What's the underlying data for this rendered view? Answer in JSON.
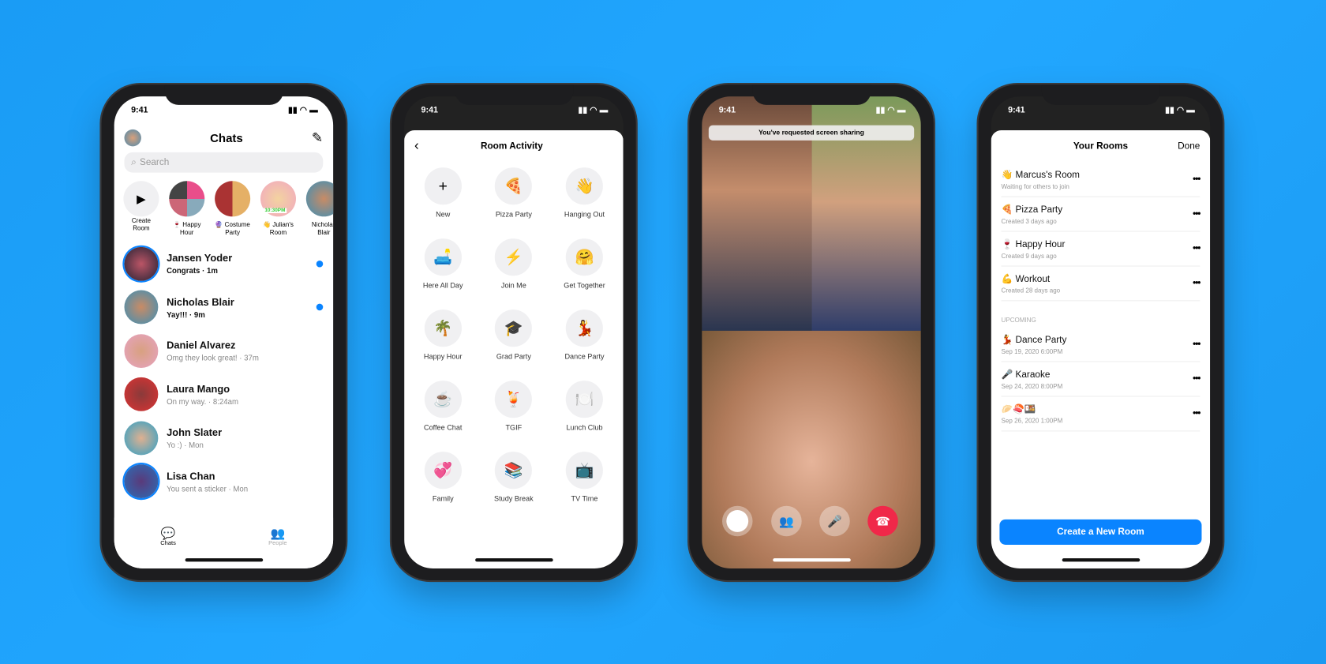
{
  "status_time": "9:41",
  "chats": {
    "title": "Chats",
    "search_placeholder": "Search",
    "stories": [
      {
        "label": "Create Room"
      },
      {
        "label": "🍷 Happy Hour"
      },
      {
        "label": "🔮 Costume Party"
      },
      {
        "label": "👋 Julian's Room",
        "badge": "10:30PM"
      },
      {
        "label": "Nicholas Blair"
      }
    ],
    "items": [
      {
        "name": "Jansen Yoder",
        "preview": "Congrats · 1m",
        "unread": true
      },
      {
        "name": "Nicholas Blair",
        "preview": "Yay!!! · 9m",
        "unread": true
      },
      {
        "name": "Daniel Alvarez",
        "preview": "Omg they look great! · 37m",
        "unread": false
      },
      {
        "name": "Laura Mango",
        "preview": "On my way. · 8:24am",
        "unread": false
      },
      {
        "name": "John Slater",
        "preview": "Yo :) · Mon",
        "unread": false
      },
      {
        "name": "Lisa Chan",
        "preview": "You sent a sticker · Mon",
        "unread": false
      }
    ],
    "tabs": [
      {
        "label": "Chats"
      },
      {
        "label": "People"
      }
    ]
  },
  "activity": {
    "title": "Room Activity",
    "items": [
      {
        "emoji": "+",
        "label": "New"
      },
      {
        "emoji": "🍕",
        "label": "Pizza Party"
      },
      {
        "emoji": "👋",
        "label": "Hanging Out"
      },
      {
        "emoji": "🛋️",
        "label": "Here All Day"
      },
      {
        "emoji": "⚡",
        "label": "Join Me"
      },
      {
        "emoji": "🤗",
        "label": "Get Together"
      },
      {
        "emoji": "🌴",
        "label": "Happy Hour"
      },
      {
        "emoji": "🎓",
        "label": "Grad Party"
      },
      {
        "emoji": "💃",
        "label": "Dance Party"
      },
      {
        "emoji": "☕",
        "label": "Coffee Chat"
      },
      {
        "emoji": "🍹",
        "label": "TGIF"
      },
      {
        "emoji": "🍽️",
        "label": "Lunch Club"
      },
      {
        "emoji": "💞",
        "label": "Family"
      },
      {
        "emoji": "📚",
        "label": "Study Break"
      },
      {
        "emoji": "📺",
        "label": "TV Time"
      }
    ]
  },
  "call": {
    "banner": "You've requested screen sharing",
    "end_color": "#f02849"
  },
  "rooms": {
    "title": "Your Rooms",
    "done": "Done",
    "upcoming_label": "UPCOMING",
    "create_button": "Create a New Room",
    "accent": "#0a84ff",
    "active": [
      {
        "emoji": "👋",
        "name": "Marcus's Room",
        "sub": "Waiting for others to join"
      },
      {
        "emoji": "🍕",
        "name": "Pizza Party",
        "sub": "Created 3 days ago"
      },
      {
        "emoji": "🍷",
        "name": "Happy Hour",
        "sub": "Created 9 days ago"
      },
      {
        "emoji": "💪",
        "name": "Workout",
        "sub": "Created 28 days ago"
      }
    ],
    "upcoming": [
      {
        "emoji": "💃",
        "name": "Dance Party",
        "sub": "Sep 19, 2020   6:00PM"
      },
      {
        "emoji": "🎤",
        "name": "Karaoke",
        "sub": "Sep 24, 2020   8:00PM"
      },
      {
        "emoji": "🥟🍣🍱",
        "name": "",
        "sub": "Sep 26, 2020   1:00PM"
      }
    ]
  }
}
